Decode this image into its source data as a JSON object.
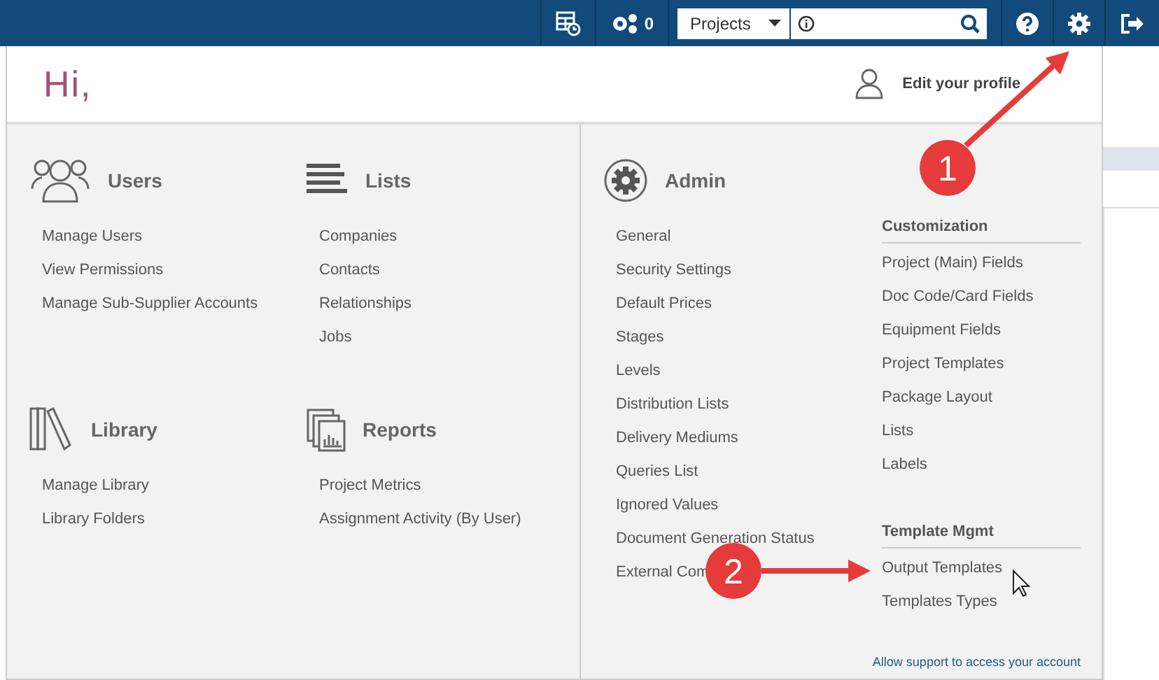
{
  "top_bar": {
    "notifications_count": "0",
    "search_scope": "Projects"
  },
  "greeting": "Hi,",
  "profile_link": "Edit your profile",
  "sections": [
    {
      "kind": "users",
      "title": "Users",
      "items": [
        "Manage Users",
        "View Permissions",
        "Manage Sub-Supplier Accounts"
      ]
    },
    {
      "kind": "lists",
      "title": "Lists",
      "items": [
        "Companies",
        "Contacts",
        "Relationships",
        "Jobs"
      ]
    },
    {
      "kind": "library",
      "title": "Library",
      "items": [
        "Manage Library",
        "Library Folders"
      ]
    },
    {
      "kind": "reports",
      "title": "Reports",
      "items": [
        "Project Metrics",
        "Assignment Activity (By User)"
      ]
    }
  ],
  "admin": {
    "title": "Admin",
    "items": [
      "General",
      "Security Settings",
      "Default Prices",
      "Stages",
      "Levels",
      "Distribution Lists",
      "Delivery Mediums",
      "Queries List",
      "Ignored Values",
      "Document Generation Status",
      "External Com"
    ],
    "groups": [
      {
        "title": "Customization",
        "items": [
          "Project (Main) Fields",
          "Doc Code/Card Fields",
          "Equipment Fields",
          "Project Templates",
          "Package Layout",
          "Lists",
          "Labels"
        ]
      },
      {
        "title": "Template Mgmt",
        "items": [
          "Output Templates",
          "Templates Types"
        ]
      }
    ]
  },
  "support_link": "Allow support to access your account",
  "annotations": [
    {
      "number": "1"
    },
    {
      "number": "2"
    }
  ]
}
